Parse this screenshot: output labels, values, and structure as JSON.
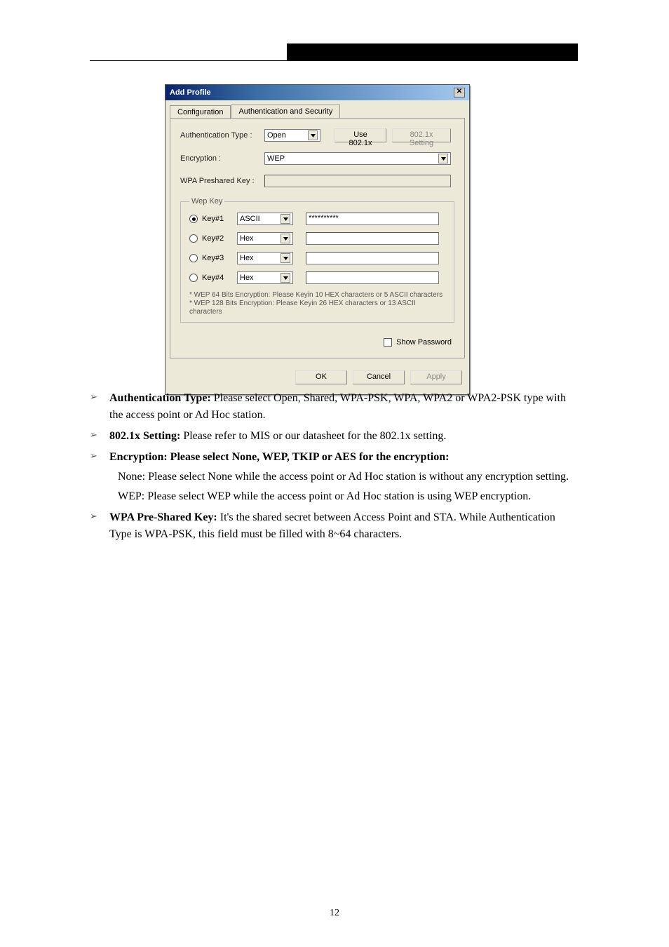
{
  "header": {
    "bar_visible": true
  },
  "dialog": {
    "title": "Add Profile",
    "close_symbol": "✕",
    "tabs": {
      "configuration": "Configuration",
      "authsec": "Authentication and Security"
    },
    "auth_type_label": "Authentication Type :",
    "auth_type_value": "Open",
    "use8021x_label": "Use 802.1x",
    "btn8021x_label": "802.1x Setting",
    "encryption_label": "Encryption :",
    "encryption_value": "WEP",
    "wpa_psk_label": "WPA Preshared Key :",
    "wepkey_legend": "Wep Key",
    "keys": [
      {
        "label": "Key#1",
        "type": "ASCII",
        "value": "**********",
        "selected": true
      },
      {
        "label": "Key#2",
        "type": "Hex",
        "value": "",
        "selected": false
      },
      {
        "label": "Key#3",
        "type": "Hex",
        "value": "",
        "selected": false
      },
      {
        "label": "Key#4",
        "type": "Hex",
        "value": "",
        "selected": false
      }
    ],
    "note1": "* WEP 64 Bits Encryption:  Please Keyin 10 HEX characters or 5 ASCII characters",
    "note2": "* WEP 128 Bits Encryption:  Please Keyin 26 HEX characters or 13 ASCII characters",
    "show_password_label": "Show Password",
    "ok_label": "OK",
    "cancel_label": "Cancel",
    "apply_label": "Apply"
  },
  "doc": {
    "bullet1_prefix": "Authentication Type:",
    "bullet1_rest": " Please select Open, Shared, WPA-PSK, WPA, WPA2 or WPA2-PSK type with the access point or Ad Hoc station.",
    "bullet2_prefix": "802.1x Setting:",
    "bullet2_rest": " Please refer to MIS or our datasheet for the 802.1x setting.",
    "bullet3_prefix": "Encryption: Please select None, WEP, TKIP or AES for the encryption:",
    "bullet3_sub1": "None: Please select None while the access point or Ad Hoc station is without any encryption setting.",
    "bullet3_sub2": "WEP: Please select WEP while the access point or Ad Hoc station is using WEP encryption.",
    "bullet4_prefix": "WPA Pre-Shared Key:",
    "bullet4_rest": " It's the shared secret between Access Point and STA. While Authentication Type is WPA-PSK, this field must be filled with 8~64 characters."
  },
  "footer": {
    "page_number": "12"
  }
}
